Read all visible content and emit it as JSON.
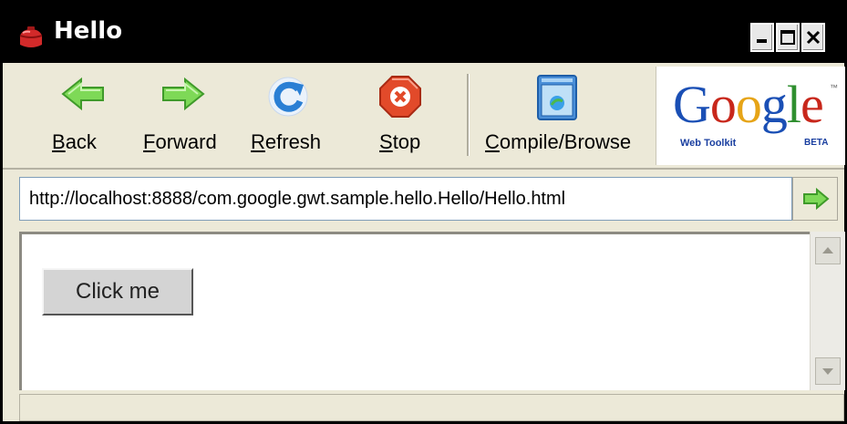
{
  "window": {
    "title": "Hello",
    "app_icon": "gwt-toolbox-icon",
    "controls": {
      "minimize": "minimize-icon",
      "maximize": "maximize-icon",
      "close": "close-icon"
    }
  },
  "toolbar": {
    "back": {
      "mnemonic": "B",
      "rest": "ack",
      "icon": "back-arrow-icon"
    },
    "forward": {
      "mnemonic": "F",
      "rest": "orward",
      "icon": "forward-arrow-icon"
    },
    "refresh": {
      "mnemonic": "R",
      "rest": "efresh",
      "icon": "refresh-icon"
    },
    "stop": {
      "mnemonic": "S",
      "rest": "top",
      "icon": "stop-icon"
    },
    "compile": {
      "mnemonic": "C",
      "rest": "ompile/Browse",
      "icon": "compile-browse-icon"
    }
  },
  "logo": {
    "letters": [
      "G",
      "o",
      "o",
      "g",
      "l",
      "e"
    ],
    "colors": [
      "#1a4fb5",
      "#c8271b",
      "#e6a417",
      "#1a4fb5",
      "#2f8f2f",
      "#c8271b"
    ],
    "subtitle": "Web Toolkit",
    "beta": "BETA",
    "tm": "™"
  },
  "address": {
    "url": "http://localhost:8888/com.google.gwt.sample.hello.Hello/Hello.html",
    "go_icon": "go-arrow-icon"
  },
  "page": {
    "button_label": "Click me"
  },
  "scrollbar": {
    "up_icon": "scroll-up-icon",
    "down_icon": "scroll-down-icon"
  },
  "colors": {
    "arrow_green": "#6fcf4f",
    "refresh_blue": "#2a7fd4",
    "stop_red": "#e24a2a"
  }
}
